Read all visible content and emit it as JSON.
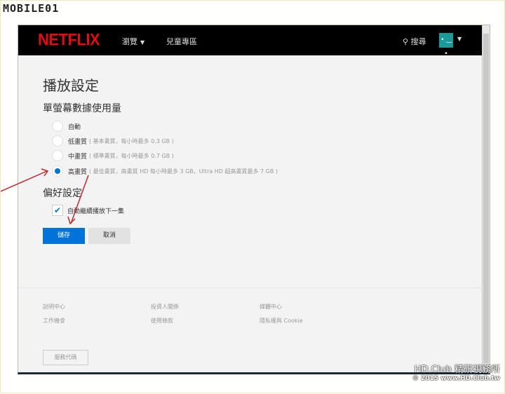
{
  "watermark_logo": "MOBILE01",
  "header": {
    "brand": "NETFLIX",
    "browse": "瀏覽",
    "kids": "兒童專區",
    "search": "搜尋",
    "avatar_face": "• ‿ •"
  },
  "page_title": "播放設定",
  "data_usage": {
    "heading": "單螢幕數據使用量",
    "options": [
      {
        "label": "自動",
        "desc": "",
        "selected": false
      },
      {
        "label": "低畫質",
        "desc": "( 基本畫質，每小時最多 0.3 GB )",
        "selected": false
      },
      {
        "label": "中畫質",
        "desc": "( 標準畫質，每小時最多 0.7 GB )",
        "selected": false
      },
      {
        "label": "高畫質",
        "desc": "( 最佳畫質，高畫質 HD 每小時最多 3 GB，Ultra HD 超高畫質最多 7 GB )",
        "selected": true
      }
    ]
  },
  "preferences": {
    "heading": "偏好設定",
    "autoplay": "自動繼續播放下一集",
    "autoplay_checked": true
  },
  "buttons": {
    "save": "儲存",
    "cancel": "取消"
  },
  "footer": {
    "links": [
      "說明中心",
      "投資人關係",
      "媒體中心",
      "工作機會",
      "使用條款",
      "隱私權與 Cookie"
    ],
    "service_code": "服務代碼"
  },
  "site_watermark": {
    "line1": "HD.Club 精研視務所",
    "line2": "© 2015  www.HD.Club.tw"
  },
  "colors": {
    "accent": "#0073d9",
    "brand": "#e50914"
  }
}
